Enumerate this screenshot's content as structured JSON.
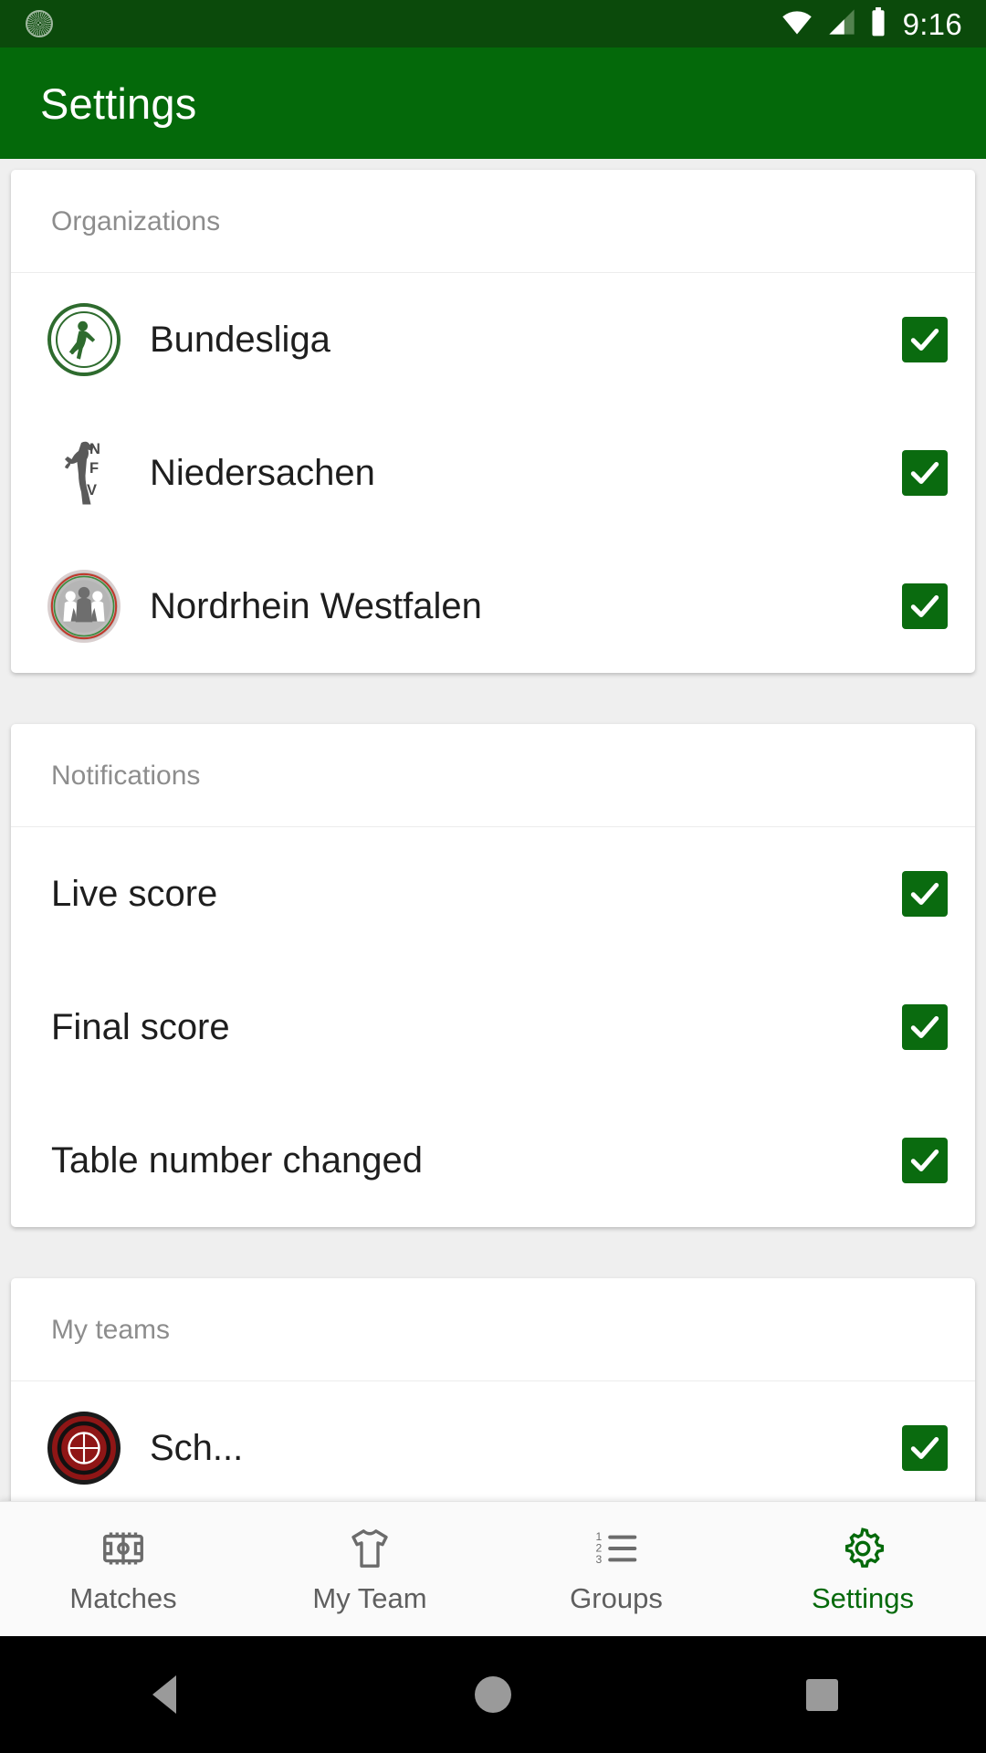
{
  "status_bar": {
    "time": "9:16",
    "icons": [
      "app-notification-icon",
      "wifi-icon",
      "cellular-signal-icon",
      "battery-icon"
    ]
  },
  "app_bar": {
    "title": "Settings"
  },
  "theme": {
    "status_bar_bg": "#0b4a0b",
    "app_bar_bg": "#04690a",
    "accent": "#04690a",
    "checkbox_bg": "#0a6b0f",
    "page_bg": "#efefef",
    "card_bg": "#ffffff",
    "header_text": "#8d8d8d",
    "row_text": "#1e1e1e"
  },
  "sections": [
    {
      "header": "Organizations",
      "rows": [
        {
          "label": "Bundesliga",
          "logo": "bundesliga-logo",
          "checked": true
        },
        {
          "label": "Niedersachen",
          "logo": "nfv-horse-logo",
          "checked": true
        },
        {
          "label": "Nordrhein Westfalen",
          "logo": "fvn-crest-logo",
          "checked": true
        }
      ]
    },
    {
      "header": "Notifications",
      "rows": [
        {
          "label": "Live score",
          "checked": true
        },
        {
          "label": "Final score",
          "checked": true
        },
        {
          "label": "Table number changed",
          "checked": true
        }
      ]
    },
    {
      "header": "My teams",
      "rows": [
        {
          "label": "Sch...",
          "logo": "team-badge-logo",
          "checked": true
        }
      ]
    }
  ],
  "bottom_nav": {
    "items": [
      {
        "label": "Matches",
        "icon": "pitch-icon",
        "active": false
      },
      {
        "label": "My Team",
        "icon": "jersey-icon",
        "active": false
      },
      {
        "label": "Groups",
        "icon": "ordered-list-icon",
        "active": false
      },
      {
        "label": "Settings",
        "icon": "gear-icon",
        "active": true
      }
    ]
  },
  "system_nav": {
    "buttons": [
      "back-button",
      "home-button",
      "recents-button"
    ]
  }
}
